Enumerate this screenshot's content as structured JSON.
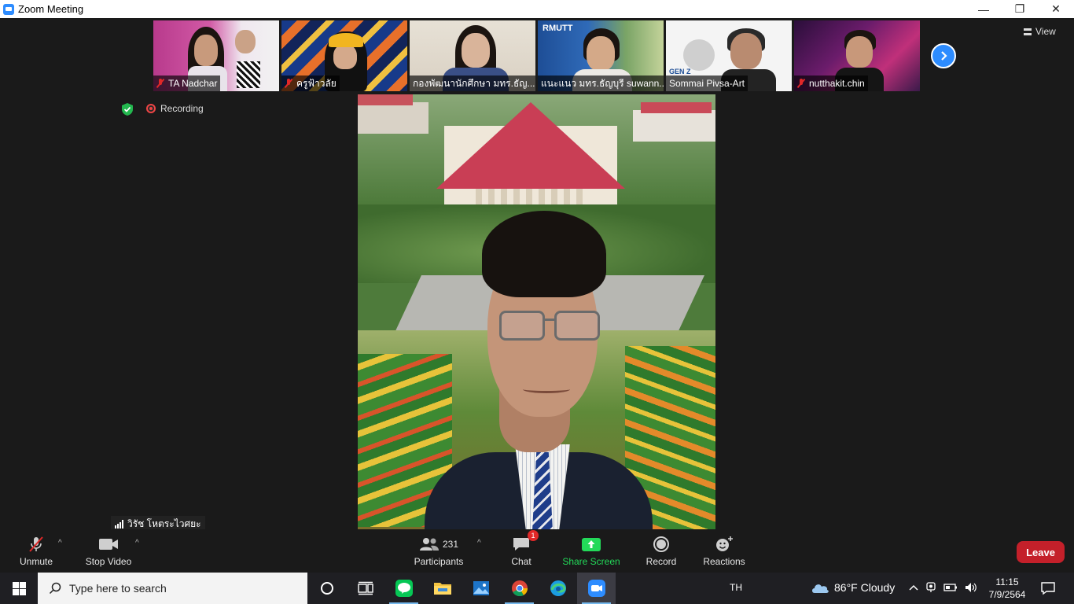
{
  "window": {
    "title": "Zoom Meeting",
    "minimize": "—",
    "restore": "❐",
    "close": "✕"
  },
  "stage": {
    "view_label": "View",
    "recording_label": "Recording",
    "thumbnails": [
      {
        "name": "TA Nadchar",
        "muted": true
      },
      {
        "name": "ครูฟ้าวลัย",
        "muted": true
      },
      {
        "name": "กองพัฒนานักศึกษา มทร.ธัญ...",
        "muted": false
      },
      {
        "name": "แนะแนว มทร.ธัญบุรี suwann...",
        "muted": false
      },
      {
        "name": "Sommai Pivsa-Art",
        "muted": false
      },
      {
        "name": "nutthakit.chin",
        "muted": true
      }
    ],
    "thumb_text": {
      "rmutt_logo": "RMUTT",
      "gen_z": "GEN Z"
    },
    "active_speaker": "วิรัช  โหตระไวศยะ"
  },
  "toolbar": {
    "unmute": "Unmute",
    "stop_video": "Stop Video",
    "participants": "Participants",
    "participant_count": "231",
    "chat": "Chat",
    "chat_badge": "1",
    "share_screen": "Share Screen",
    "record": "Record",
    "reactions": "Reactions",
    "leave": "Leave",
    "caret": "^"
  },
  "taskbar": {
    "search_placeholder": "Type here to search",
    "language": "TH",
    "weather": "86°F  Cloudy",
    "time": "11:15",
    "date": "7/9/2564"
  },
  "colors": {
    "accent": "#2d8cff",
    "leave": "#c4202a",
    "share": "#23d959",
    "muted": "#e02828"
  }
}
